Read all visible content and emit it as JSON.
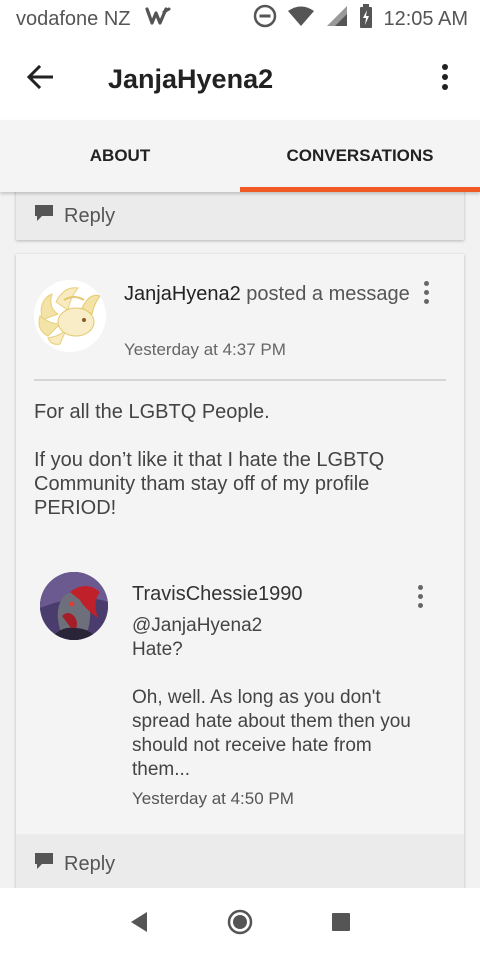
{
  "status_bar": {
    "carrier": "vodafone NZ",
    "time": "12:05 AM",
    "icons": [
      "w-app-icon",
      "dnd-icon",
      "wifi-icon",
      "signal-icon",
      "battery-charging-icon"
    ]
  },
  "app_bar": {
    "title": "JanjaHyena2",
    "back_icon": "arrow-left-icon",
    "menu_icon": "more-vertical-icon"
  },
  "tabs": [
    {
      "label": "ABOUT",
      "active": false
    },
    {
      "label": "CONVERSATIONS",
      "active": true
    }
  ],
  "accent_color": "#f15a24",
  "top_card": {
    "reply_label": "Reply"
  },
  "post": {
    "author": "JanjaHyena2",
    "action": " posted a message",
    "time": "Yesterday at 4:37 PM",
    "body": [
      "For all the LGBTQ People.",
      "If you don’t like it that I hate the LGBTQ Community tham stay off of my profile PERIOD!"
    ],
    "comment": {
      "author": "TravisChessie1990",
      "lines": [
        "@JanjaHyena2\nHate?",
        "Oh, well. As long as you don't spread hate about them then you should not receive hate from them..."
      ],
      "time": "Yesterday at 4:50 PM"
    },
    "reply_label": "Reply"
  },
  "nav_bar": {
    "icons": [
      "back-triangle-icon",
      "home-circle-icon",
      "recents-square-icon"
    ]
  }
}
